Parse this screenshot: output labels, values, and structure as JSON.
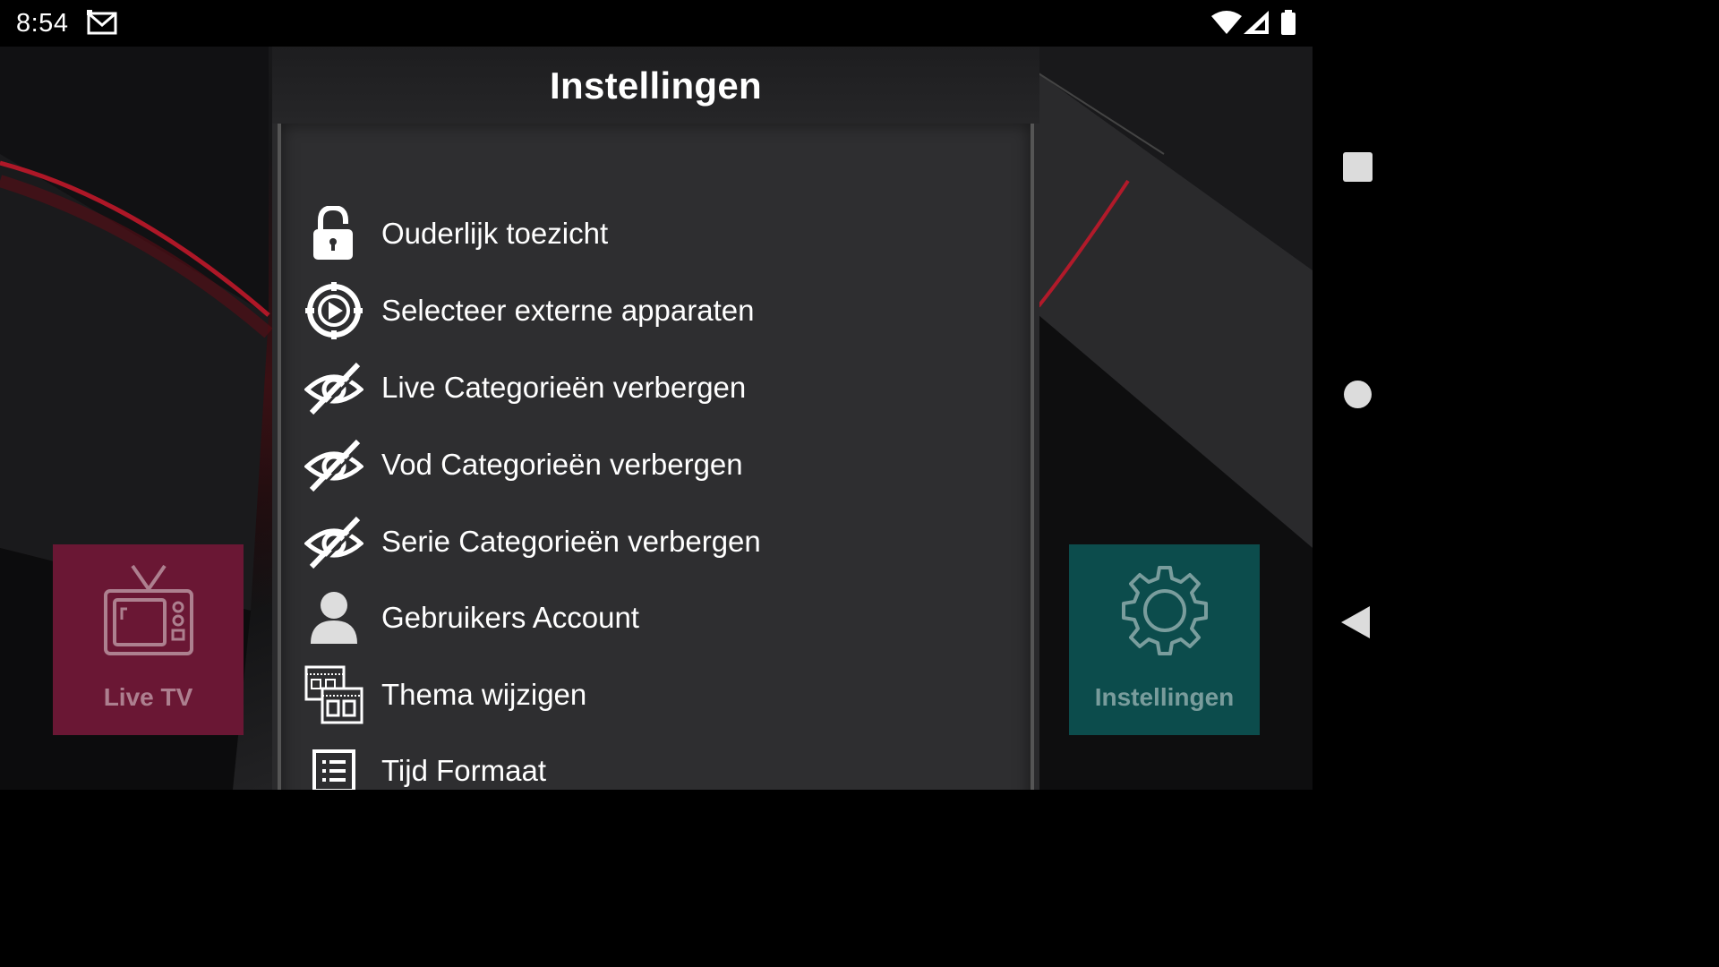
{
  "status_bar": {
    "time": "8:54",
    "icons": [
      "gmail-icon",
      "wifi-icon",
      "signal-icon",
      "battery-icon"
    ]
  },
  "dialog": {
    "title": "Instellingen",
    "items": [
      {
        "label": "Ouderlijk toezicht",
        "icon": "lock-icon"
      },
      {
        "label": "Selecteer externe apparaten",
        "icon": "play-circle-icon"
      },
      {
        "label": "Live Categorieën verbergen",
        "icon": "eye-off-icon"
      },
      {
        "label": "Vod Categorieën verbergen",
        "icon": "eye-off-icon"
      },
      {
        "label": "Serie Categorieën verbergen",
        "icon": "eye-off-icon"
      },
      {
        "label": "Gebruikers Account",
        "icon": "user-icon"
      },
      {
        "label": "Thema wijzigen",
        "icon": "theme-icon"
      },
      {
        "label": "Tijd Formaat",
        "icon": "list-icon"
      }
    ]
  },
  "tiles": {
    "live_tv": {
      "label": "Live TV",
      "icon": "tv-icon",
      "color": "#6a1734"
    },
    "settings": {
      "label": "Instellingen",
      "icon": "gear-icon",
      "color": "#0c4c4c"
    }
  },
  "nav_bar": {
    "buttons": [
      "recents-button",
      "home-button",
      "back-button"
    ]
  }
}
